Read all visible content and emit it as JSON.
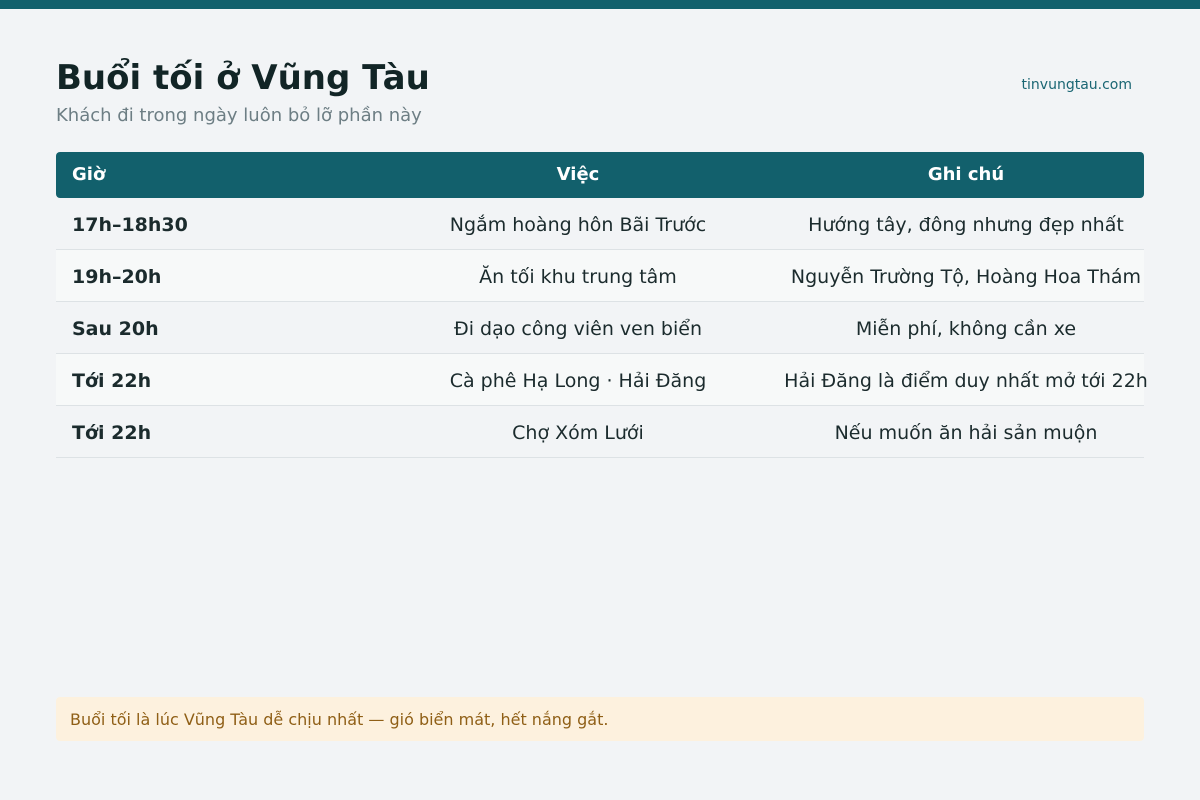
{
  "header": {
    "title": "Buổi tối ở Vũng Tàu",
    "subtitle": "Khách đi trong ngày luôn bỏ lỡ phần này",
    "site": "tinvungtau.com"
  },
  "table": {
    "columns": [
      "Giờ",
      "Việc",
      "Ghi chú"
    ],
    "rows": [
      {
        "time": "17h–18h30",
        "activity": "Ngắm hoàng hôn Bãi Trước",
        "note": "Hướng tây, đông nhưng đẹp nhất"
      },
      {
        "time": "19h–20h",
        "activity": "Ăn tối khu trung tâm",
        "note": "Nguyễn Trường Tộ, Hoàng Hoa Thám"
      },
      {
        "time": "Sau 20h",
        "activity": "Đi dạo công viên ven biển",
        "note": "Miễn phí, không cần xe"
      },
      {
        "time": "Tới 22h",
        "activity": "Cà phê Hạ Long · Hải Đăng",
        "note": "Hải Đăng là điểm duy nhất mở tới 22h"
      },
      {
        "time": "Tới 22h",
        "activity": "Chợ Xóm Lưới",
        "note": "Nếu muốn ăn hải sản muộn"
      }
    ]
  },
  "footer_note": "Buổi tối là lúc Vũng Tàu dễ chịu nhất — gió biển mát, hết nắng gắt.",
  "colors": {
    "accent": "#12606c",
    "background": "#f2f4f6",
    "note_background": "#fdf1de",
    "note_text": "#8f5f16"
  }
}
